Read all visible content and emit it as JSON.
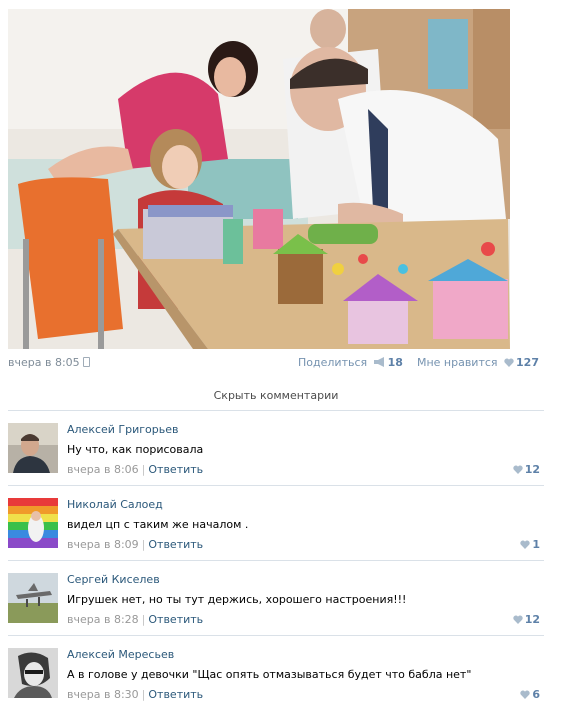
{
  "post": {
    "timestamp": "вчера в 8:05",
    "share_label": "Поделиться",
    "share_count": "18",
    "like_label": "Мне нравится",
    "like_count": "127",
    "icons": {
      "device": "phone-icon",
      "share": "megaphone-icon",
      "like": "heart-icon"
    }
  },
  "comments_toggle": "Скрыть комментарии",
  "comments": [
    {
      "author": "Алексей Григорьев",
      "text": "Ну что, как порисовала",
      "time": "вчера в 8:06",
      "reply": "Ответить",
      "likes": "12"
    },
    {
      "author": "Николай Салоед",
      "text": "видел цп с таким же началом .",
      "time": "вчера в 8:09",
      "reply": "Ответить",
      "likes": "1"
    },
    {
      "author": "Сергей Киселев",
      "text": "Игрушек нет, но ты тут держись, хорошего настроения!!!",
      "time": "вчера в 8:28",
      "reply": "Ответить",
      "likes": "12"
    },
    {
      "author": "Алексей Мересьев",
      "text": "А в голове у девочки \"Щас опять отмазываться будет что бабла нет\"",
      "time": "вчера в 8:30",
      "reply": "Ответить",
      "likes": "6"
    }
  ],
  "colors": {
    "link": "#2b587a",
    "muted": "#999999",
    "like": "#5e81a8",
    "divider": "#dae1e8"
  }
}
